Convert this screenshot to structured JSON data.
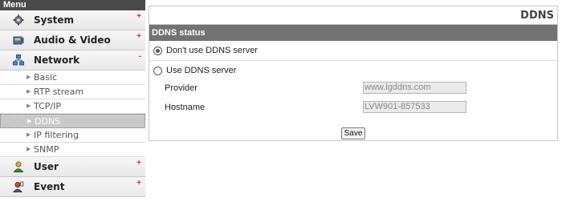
{
  "sidebar": {
    "header": "Menu",
    "menus": [
      {
        "label": "System",
        "icon": "gear-icon",
        "sign": "+"
      },
      {
        "label": "Audio & Video",
        "icon": "video-icon",
        "sign": "+"
      },
      {
        "label": "Network",
        "icon": "network-icon",
        "sign": "-"
      },
      {
        "label": "User",
        "icon": "user-icon",
        "sign": "+"
      },
      {
        "label": "Event",
        "icon": "event-icon",
        "sign": "+"
      }
    ],
    "network_sub": [
      "Basic",
      "RTP stream",
      "TCP/IP",
      "DDNS",
      "IP filtering",
      "SNMP"
    ],
    "active_sub": "DDNS"
  },
  "main": {
    "title": "DDNS",
    "section": "DDNS status",
    "options": [
      {
        "label": "Don't use DDNS server",
        "selected": true
      },
      {
        "label": "Use DDNS server",
        "selected": false
      }
    ],
    "provider": {
      "label": "Provider",
      "value": "www.lgddns.com"
    },
    "hostname": {
      "label": "Hostname",
      "value": "LVW901-857533"
    },
    "save_label": "Save"
  },
  "colors": {
    "accent_plus": "#e0302a",
    "header_bg": "#727272",
    "menu_header_bg": "#4a4a4a"
  }
}
